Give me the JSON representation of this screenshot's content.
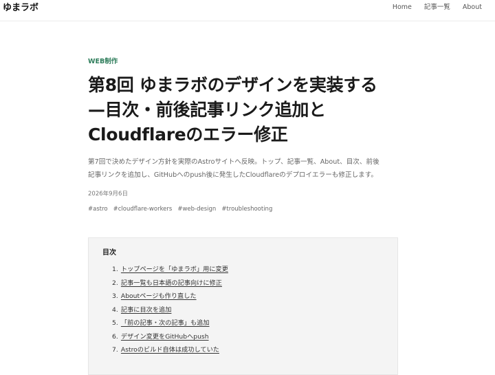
{
  "header": {
    "logo": "ゆまラボ",
    "nav": [
      {
        "label": "Home"
      },
      {
        "label": "記事一覧"
      },
      {
        "label": "About"
      }
    ]
  },
  "article": {
    "category": "WEB制作",
    "title_lines": [
      "第8回 ゆまラボのデザインを実装する",
      "—目次・前後記事リンク追加と",
      "Cloudflareのエラー修正"
    ],
    "lead_lines": [
      "第7回で決めたデザイン方針を実際のAstroサイトへ反映。トップ、記事一覧、About、目次、前後",
      "記事リンクを追加し、GitHubへのpush後に発生したCloudflareのデプロイエラーも修正します。"
    ],
    "date": "2026年9月6日",
    "tags": [
      "#astro",
      "#cloudflare-workers",
      "#web-design",
      "#troubleshooting"
    ]
  },
  "toc": {
    "title": "目次",
    "items": [
      {
        "num": "1.",
        "label": "トップページを「ゆまラボ」用に変更"
      },
      {
        "num": "2.",
        "label": "記事一覧も日本語の記事向けに修正"
      },
      {
        "num": "3.",
        "label": "Aboutページも作り直した"
      },
      {
        "num": "4.",
        "label": "記事に目次を追加"
      },
      {
        "num": "5.",
        "label": "「前の記事・次の記事」も追加"
      },
      {
        "num": "6.",
        "label": "デザイン変更をGitHubへpush"
      },
      {
        "num": "7.",
        "label": "Astroのビルド自体は成功していた"
      }
    ]
  }
}
